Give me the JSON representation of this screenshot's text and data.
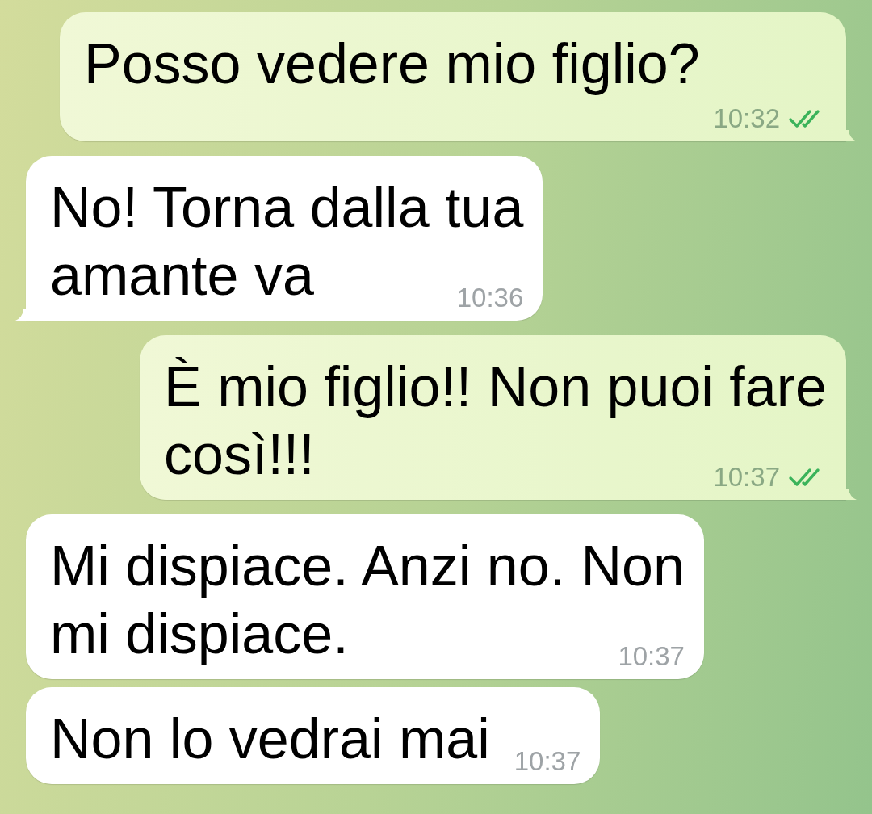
{
  "messages": [
    {
      "outgoing": true,
      "lines": [
        "Posso vedere mio figlio?"
      ],
      "time": "10:32",
      "read": true,
      "tail": true
    },
    {
      "outgoing": false,
      "lines": [
        "No! Torna dalla tua",
        "amante va"
      ],
      "time": "10:36",
      "tail": true
    },
    {
      "outgoing": true,
      "lines": [
        "È mio figlio!! Non puoi fare",
        "così!!!"
      ],
      "time": "10:37",
      "read": true,
      "tail": true
    },
    {
      "outgoing": false,
      "lines": [
        "Mi dispiace. Anzi no. Non",
        "mi dispiace."
      ],
      "time": "10:37",
      "tail": false
    },
    {
      "outgoing": false,
      "lines": [
        "Non lo vedrai mai"
      ],
      "time": "10:37",
      "tail": false
    }
  ]
}
